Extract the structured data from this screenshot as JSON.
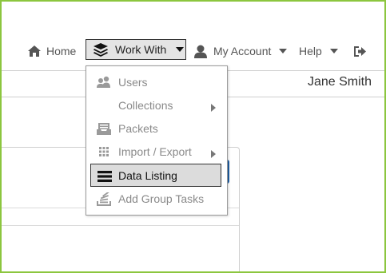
{
  "nav": {
    "home": {
      "label": "Home",
      "icon": "home-icon"
    },
    "work_with": {
      "label": "Work With",
      "icon": "layers-icon"
    },
    "my_account": {
      "label": "My Account",
      "icon": "user-icon"
    },
    "help": {
      "label": "Help"
    },
    "logout": {
      "icon": "sign-out-icon"
    }
  },
  "user": {
    "name": "Jane Smith"
  },
  "menu": {
    "items": [
      {
        "label": "Users",
        "icon": "users-icon",
        "submenu": false,
        "selected": false
      },
      {
        "label": "Collections",
        "icon": "",
        "submenu": true,
        "selected": false
      },
      {
        "label": "Packets",
        "icon": "inbox-icon",
        "submenu": false,
        "selected": false
      },
      {
        "label": "Import / Export",
        "icon": "grid-icon",
        "submenu": true,
        "selected": false
      },
      {
        "label": "Data Listing",
        "icon": "list-icon",
        "submenu": false,
        "selected": true
      },
      {
        "label": "Add Group Tasks",
        "icon": "stack-icon",
        "submenu": false,
        "selected": false
      }
    ]
  },
  "colors": {
    "frame_border": "#8cc63f",
    "selected_bg": "#dcdcdc",
    "accent": "#1f5fa6",
    "text_muted": "#8a8a8a"
  }
}
